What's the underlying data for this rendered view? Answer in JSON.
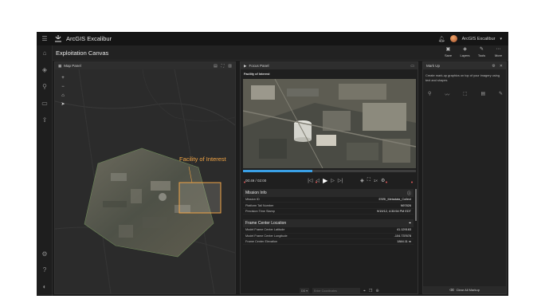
{
  "app": {
    "title": "ArcGIS Excalibur",
    "user_name": "ArcGIS Excalibur"
  },
  "page": {
    "title": "Exploitation Canvas"
  },
  "toolbar": [
    {
      "label": "Save",
      "icon": "save-icon"
    },
    {
      "label": "Layers",
      "icon": "layers-icon"
    },
    {
      "label": "Tools",
      "icon": "tools-icon"
    },
    {
      "label": "More",
      "icon": "more-icon"
    }
  ],
  "map_panel": {
    "title": "Map Panel",
    "annotation": "Facility of Interest",
    "annotation_color": "#f0a344"
  },
  "focus_panel": {
    "title": "Focus Panel",
    "subtitle": "Facility of Interest",
    "time": "00:49 / 02:00",
    "rate": "1×",
    "progress": 0.4
  },
  "mission_info": {
    "title": "Mission Info",
    "rows": [
      {
        "label": "Mission ID",
        "value": "ESRI_Metadata_Collect"
      },
      {
        "label": "Platform Tail Number",
        "value": "N97826"
      },
      {
        "label": "Precision Time Stamp",
        "value": "9/19/12, 4:30:54 PM EDT"
      }
    ]
  },
  "frame_center": {
    "title": "Frame Center Location",
    "rows": [
      {
        "label": "Model Frame Center Latitude",
        "value": "41.129163"
      },
      {
        "label": "Model Frame Center Longitude",
        "value": "-104.737678"
      },
      {
        "label": "Frame Center Elevation",
        "value": "1844.11 m"
      }
    ]
  },
  "markup_panel": {
    "title": "Mark Up",
    "description": "Create mark-up graphics on top of your imagery using text and shapes",
    "clear_label": "Clear All Markup"
  },
  "status": {
    "coordinate_format": "DD",
    "search_placeholder": "Enter Coordinates"
  },
  "colors": {
    "accent": "#3aa0e6",
    "annotation": "#f0a344",
    "background": "#1c1c1c"
  }
}
